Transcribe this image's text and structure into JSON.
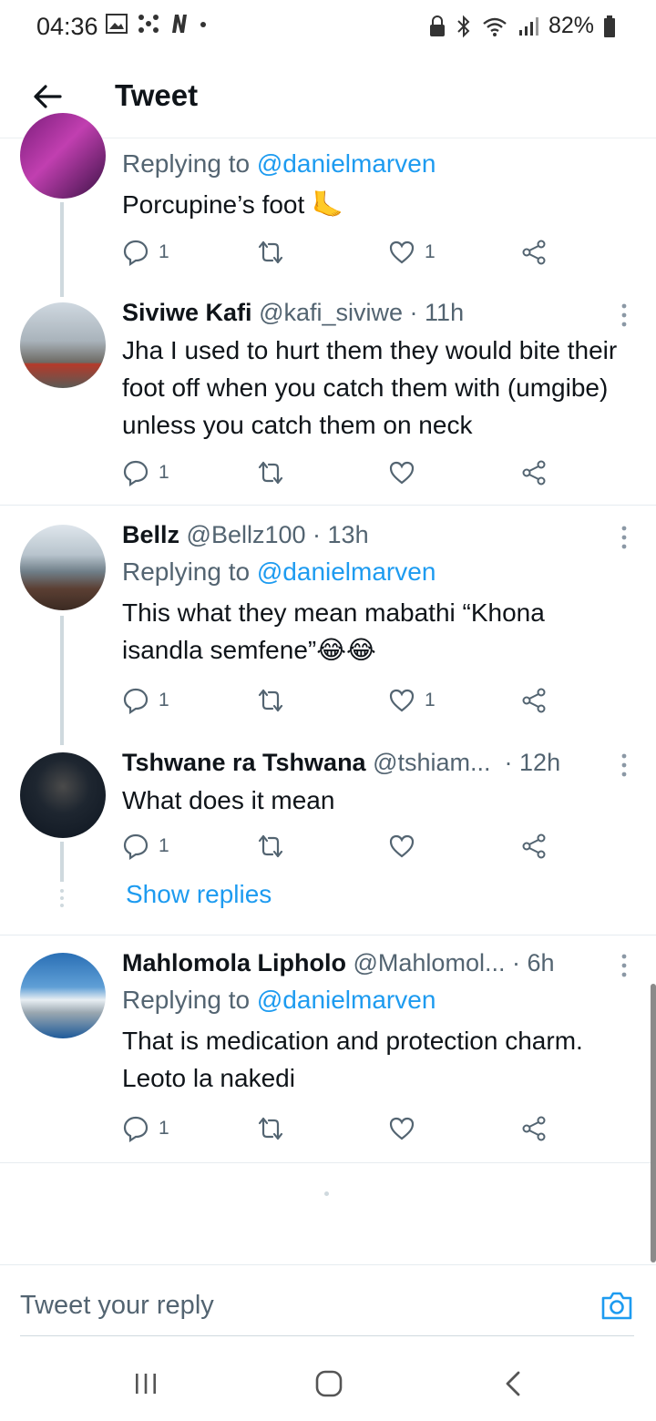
{
  "status_bar": {
    "time": "04:36",
    "battery": "82%"
  },
  "appbar": {
    "title": "Tweet"
  },
  "tweets": [
    {
      "reply_prefix": "Replying to ",
      "mention": "@danielmarven",
      "text": "Porcupine’s foot 🦶",
      "replies": "1",
      "likes": "1"
    },
    {
      "name": "Siviwe Kafi",
      "handle": "@kafi_siviwe",
      "time": "· 11h",
      "text": "Jha I used to hurt them they would bite their foot off when you catch them with (umgibe) unless you catch them on neck",
      "replies": "1",
      "likes": ""
    },
    {
      "name": "Bellz",
      "handle": "@Bellz100",
      "time": "· 13h",
      "reply_prefix": "Replying to ",
      "mention": "@danielmarven",
      "text": "This what they mean mabathi “Khona isandla semfene”😂😂",
      "replies": "1",
      "likes": "1"
    },
    {
      "name": "Tshwane ra Tshwana",
      "handle": "@tshiam...",
      "time": "· 12h",
      "text": "What does it mean",
      "replies": "1",
      "likes": ""
    },
    {
      "name": "Mahlomola Lipholo",
      "handle": "@Mahlomol...",
      "time": "· 6h",
      "reply_prefix": "Replying to ",
      "mention": "@danielmarven",
      "text": "That is medication and protection charm. Leoto la nakedi",
      "replies": "1",
      "likes": ""
    }
  ],
  "show_replies": "Show replies",
  "composer": {
    "placeholder": "Tweet your reply"
  },
  "colors": {
    "accent": "#1d9bf0",
    "muted": "#536471",
    "text": "#0f1419"
  },
  "icons": [
    "back-arrow-icon",
    "more-vertical-icon",
    "reply-icon",
    "retweet-icon",
    "heart-icon",
    "share-icon",
    "camera-icon"
  ]
}
